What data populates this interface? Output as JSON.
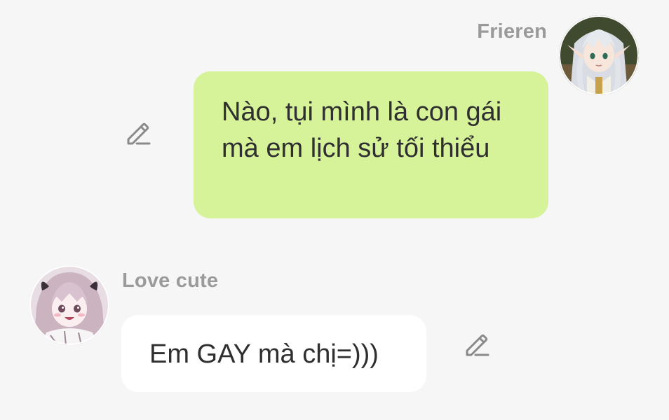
{
  "messages": [
    {
      "sender": "Frieren",
      "side": "right",
      "text": "Nào, tụi mình là con gái mà em lịch sử tối thiểu",
      "bubble_color": "#d7f39a",
      "avatar_icon": "frieren-avatar-icon",
      "action_icon": "edit-pencil-icon"
    },
    {
      "sender": "Love cute",
      "side": "left",
      "text": "Em GAY mà chị=)))",
      "bubble_color": "#ffffff",
      "avatar_icon": "love-cute-avatar-icon",
      "action_icon": "edit-pencil-icon"
    }
  ],
  "colors": {
    "background": "#f6f6f6",
    "sender_name": "#9a9a9a",
    "message_text": "#2f2f2f",
    "icon": "#8a8a8a"
  }
}
